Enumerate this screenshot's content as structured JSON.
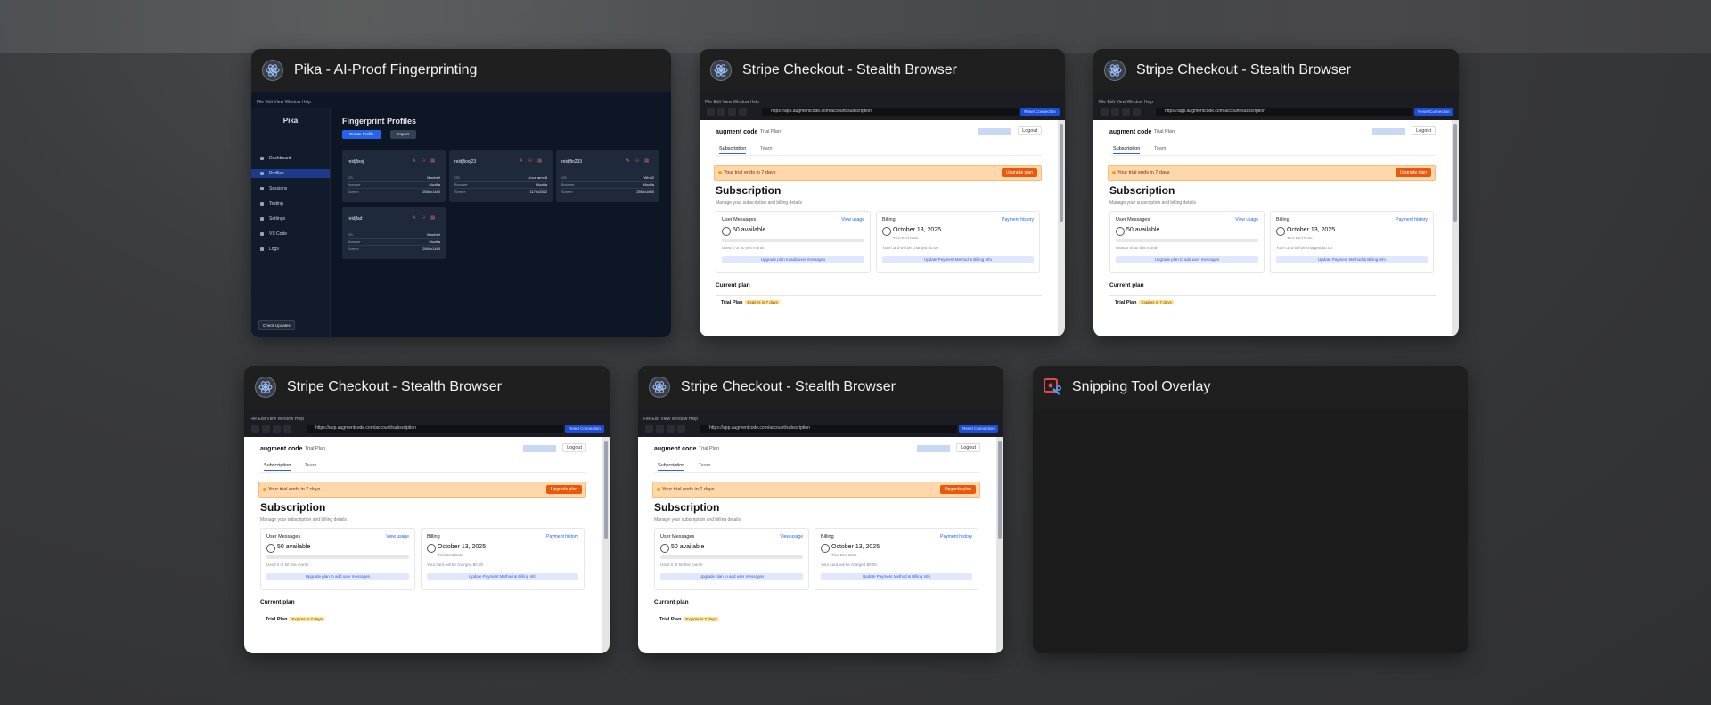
{
  "windows": [
    {
      "title": "Pika - AI-Proof Fingerprinting"
    },
    {
      "title": "Stripe Checkout - Stealth Browser"
    },
    {
      "title": "Stripe Checkout - Stealth Browser"
    },
    {
      "title": "Stripe Checkout - Stealth Browser"
    },
    {
      "title": "Stripe Checkout - Stealth Browser"
    },
    {
      "title": "Snipping Tool Overlay"
    }
  ],
  "pika": {
    "menu": "File  Edit  View  Window  Help",
    "brand": "Pika",
    "nav": [
      "Dashboard",
      "Profiles",
      "Sessions",
      "Testing",
      "Settings",
      "VS Code",
      "Logs"
    ],
    "heading": "Fingerprint Profiles",
    "create_btn": "Create Profile",
    "import_btn": "Import",
    "check_updates": "Check Updates",
    "profiles": [
      {
        "name": "reidjfisoj",
        "os": "Macintel",
        "browser": "Mozilla",
        "screen": "2560x1440"
      },
      {
        "name": "reidjfiooj23",
        "os": "Linux armv8",
        "browser": "Mozilla",
        "screen": "1170x2532"
      },
      {
        "name": "reidjfio233",
        "os": "Win32",
        "browser": "Mozilla",
        "screen": "2560x1600"
      },
      {
        "name": "reidjfad",
        "os": "Macintel",
        "browser": "Mozilla",
        "screen": "2560x1440"
      }
    ],
    "row_labels": [
      "OS",
      "Browser",
      "Screen"
    ]
  },
  "browser": {
    "menu": "File  Edit  View  Window  Help",
    "url": "https://app.augmentcode.com/account/subscription",
    "connection_btn": "Reset Connection",
    "logo": "augment code",
    "plan_label": "Trial Plan",
    "logout": "Logout",
    "tab_subscription": "Subscription",
    "tab_team": "Team",
    "banner": "Your trial ends in 7 days",
    "upgrade_btn": "Upgrade plan",
    "heading": "Subscription",
    "subheading": "Manage your subscription and billing details",
    "messages_title": "User Messages",
    "view_usage": "View usage",
    "messages_value": "50 available",
    "messages_used": "Used 0 of 50 this month",
    "messages_btn": "Upgrade plan to add user messages",
    "billing_title": "Billing",
    "payment_history": "Payment history",
    "billing_date": "October 13, 2025",
    "billing_sub": "Trial End Date",
    "billing_note": "Your card will be charged $0.00",
    "billing_btn": "Update Payment Method & Billing Info",
    "current_plan": "Current plan",
    "trial_plan": "Trial Plan",
    "trial_badge": "Expires in 7 days"
  }
}
